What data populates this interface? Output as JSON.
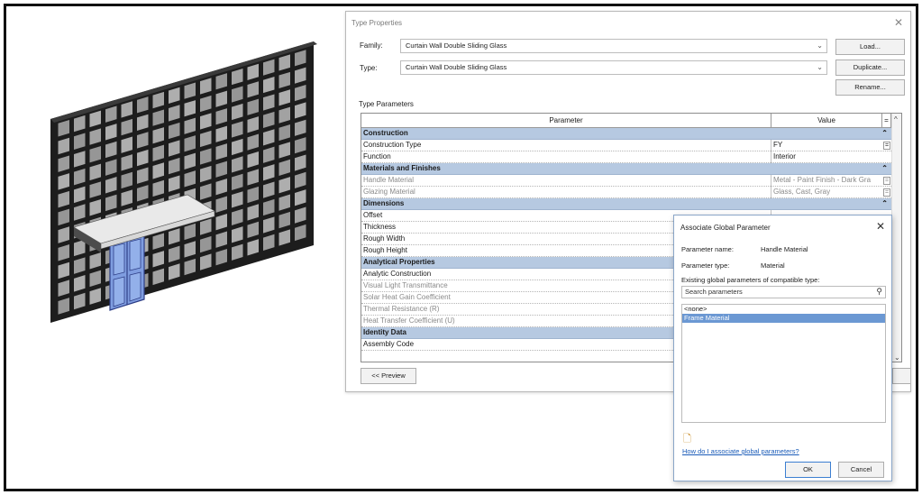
{
  "type_properties": {
    "title": "Type Properties",
    "family_label": "Family:",
    "family_value": "Curtain Wall Double Sliding Glass",
    "type_label": "Type:",
    "type_value": "Curtain Wall Double Sliding Glass",
    "load_button": "Load...",
    "duplicate_button": "Duplicate...",
    "rename_button": "Rename...",
    "type_parameters_label": "Type Parameters",
    "col_parameter": "Parameter",
    "col_value": "Value",
    "preview_button": "<< Preview",
    "groups": [
      {
        "name": "Construction",
        "rows": [
          {
            "param": "Construction Type",
            "value": "FY"
          },
          {
            "param": "Function",
            "value": "Interior"
          }
        ]
      },
      {
        "name": "Materials and Finishes",
        "rows": [
          {
            "param": "Handle Material",
            "value": "Metal - Paint Finish - Dark Gra"
          },
          {
            "param": "Glazing Material",
            "value": "Glass, Cast, Gray"
          }
        ]
      },
      {
        "name": "Dimensions",
        "rows": [
          {
            "param": "Offset",
            "value": ""
          },
          {
            "param": "Thickness",
            "value": ""
          },
          {
            "param": "Rough Width",
            "value": ""
          },
          {
            "param": "Rough Height",
            "value": ""
          }
        ]
      },
      {
        "name": "Analytical Properties",
        "rows": [
          {
            "param": "Analytic Construction",
            "value": ""
          },
          {
            "param": "Visual Light Transmittance",
            "value": ""
          },
          {
            "param": "Solar Heat Gain Coefficient",
            "value": ""
          },
          {
            "param": "Thermal Resistance (R)",
            "value": ""
          },
          {
            "param": "Heat Transfer Coefficient (U)",
            "value": ""
          }
        ]
      },
      {
        "name": "Identity Data",
        "rows": [
          {
            "param": "Assembly Code",
            "value": ""
          }
        ]
      }
    ]
  },
  "associate_global_parameter": {
    "title": "Associate Global Parameter",
    "param_name_label": "Parameter name:",
    "param_name_value": "Handle Material",
    "param_type_label": "Parameter type:",
    "param_type_value": "Material",
    "existing_label": "Existing global parameters of compatible type:",
    "search_placeholder": "Search parameters",
    "list": [
      "<none>",
      "Frame Material"
    ],
    "selected": "Frame Material",
    "help_link": "How do I associate global parameters?",
    "ok_button": "OK",
    "cancel_button": "Cancel"
  },
  "colors": {
    "group_row": "#b6c9e1",
    "selection": "#6b98d3",
    "door_glass": "#7f9de0",
    "link": "#1a5bb8"
  }
}
